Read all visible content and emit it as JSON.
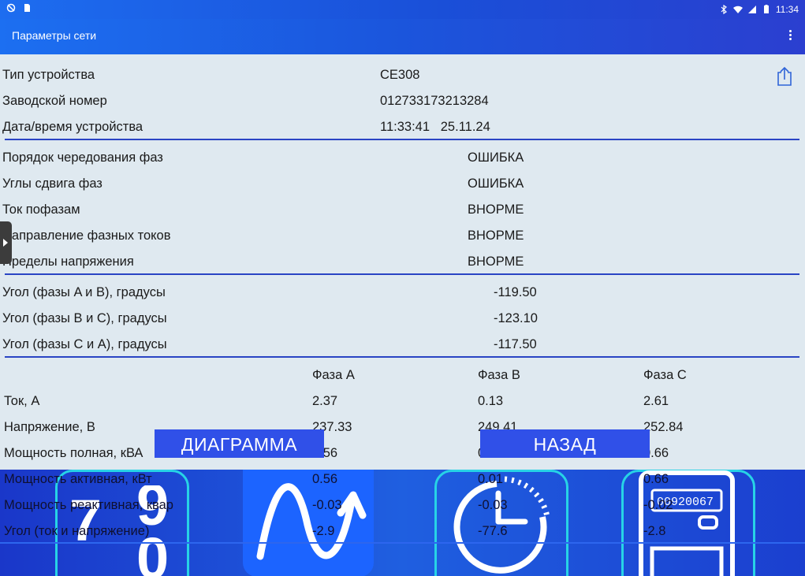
{
  "statusbar": {
    "time": "11:34"
  },
  "appbar": {
    "title": "Параметры сети"
  },
  "device": {
    "rows": [
      {
        "label": "Тип устройства",
        "value": "CE308"
      },
      {
        "label": "Заводской номер",
        "value": "012733173213284"
      },
      {
        "label": "Дата/время устройства",
        "value": "11:33:41   25.11.24"
      }
    ]
  },
  "checks": {
    "rows": [
      {
        "label": "Порядок чередования фаз",
        "value": "ОШИБКА"
      },
      {
        "label": "Углы сдвига фаз",
        "value": "ОШИБКА"
      },
      {
        "label": "Ток пофазам",
        "value": "ВНОРМЕ"
      },
      {
        "label": "Направление фазных токов",
        "value": "ВНОРМЕ"
      },
      {
        "label": "Пределы напряжения",
        "value": "ВНОРМЕ"
      }
    ]
  },
  "angles": {
    "rows": [
      {
        "label": "Угол (фазы A и B), градусы",
        "value": "-119.50"
      },
      {
        "label": "Угол (фазы B и C), градусы",
        "value": "-123.10"
      },
      {
        "label": "Угол (фазы C и A), градусы",
        "value": "-117.50"
      }
    ]
  },
  "phase_table": {
    "columns": [
      "Фаза A",
      "Фаза B",
      "Фаза C"
    ],
    "rows": [
      {
        "label": "Ток, А",
        "a": "2.37",
        "b": "0.13",
        "c": "2.61"
      },
      {
        "label": "Напряжение, В",
        "a": "237.33",
        "b": "249.41",
        "c": "252.84"
      },
      {
        "label": "Мощность полная, кВА",
        "a": "0.56",
        "b": "0.03",
        "c": "0.66"
      },
      {
        "label": "Мощность активная, кВт",
        "a": "0.56",
        "b": "0.01",
        "c": "0.66"
      },
      {
        "label": "Мощность реактивная, квар",
        "a": "-0.03",
        "b": "-0.03",
        "c": "-0.02"
      },
      {
        "label": "Угол (ток и напряжение)",
        "a": "-2.9",
        "b": "-77.6",
        "c": "-2.8"
      }
    ]
  },
  "buttons": {
    "diagram": "ДИАГРАММА",
    "back": "НАЗАД"
  },
  "meter_display": "00920067"
}
